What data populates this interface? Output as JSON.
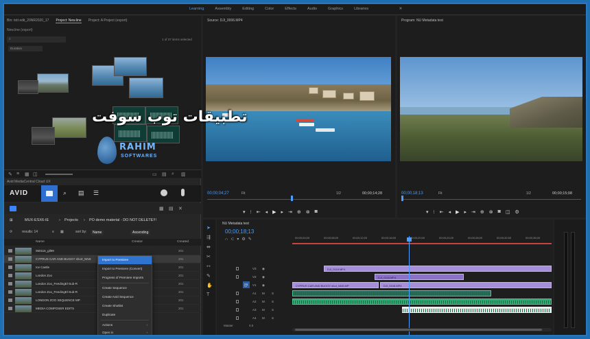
{
  "workspaces": {
    "items": [
      "Learning",
      "Assembly",
      "Editing",
      "Color",
      "Effects",
      "Audio",
      "Graphics",
      "Libraries"
    ],
    "active": "Learning",
    "more": "»"
  },
  "project": {
    "tabs": [
      "Bin: tott edit_20NR2020_17",
      "Project: New.line",
      "Project: A Project (export)"
    ],
    "bin_label": "New.line (export)",
    "search_placeholder": "",
    "item_count": "1 of 37 items selected",
    "dropdown": "Duration"
  },
  "watermark": {
    "line1": "RAHIM",
    "line2": "SOFTWARES"
  },
  "avid": {
    "panel_title": "Avid MediaCentral Cloud UX",
    "logo": "AVID",
    "breadcrumb": [
      "MUX-ESX6-IE",
      "Projects",
      "PO demo material - DO NOT DELETE!!!"
    ],
    "results": "results: 14",
    "sort_by_label": "sort by:",
    "sort_field": "Name",
    "sort_order": "Ascending",
    "columns": [
      "Name",
      "Creator",
      "Created"
    ],
    "rows": [
      {
        "name": "060116_gil99",
        "created": "201"
      },
      {
        "name": "CYPRUS CAR AND BUGGY short_NNS",
        "created": "201"
      },
      {
        "name": "Ice Castle",
        "created": "201"
      },
      {
        "name": "London Zoo",
        "created": "201"
      },
      {
        "name": "London Zoo_FeedingEl-Sub-R",
        "created": "201"
      },
      {
        "name": "London Zoo_FeedingEl-Sub-R",
        "created": "201"
      },
      {
        "name": "LONDON ZOO SEQUENCE MP",
        "created": "201"
      },
      {
        "name": "MEDIA COMPOSER EDITS",
        "created": "201"
      }
    ],
    "context_menu": [
      {
        "label": "Import to Premiere",
        "highlight": true
      },
      {
        "label": "Import to Premiere (Convert)",
        "highlight": false
      },
      {
        "label": "Progress of Premiere Imports",
        "highlight": false
      },
      {
        "label": "Create Sequence",
        "highlight": false
      },
      {
        "label": "Create Avid Sequence",
        "highlight": false
      },
      {
        "label": "Create Shotlist",
        "highlight": false
      },
      {
        "label": "Duplicate",
        "highlight": false
      },
      {
        "label": "Actions",
        "highlight": false
      },
      {
        "label": "Open in",
        "highlight": false
      }
    ]
  },
  "source": {
    "title": "Source: DJI_0006.MP4",
    "timecode": "00;00;04;27",
    "fit": "Fit",
    "duration": "00;00;14;28",
    "fraction": "1/2"
  },
  "program": {
    "title": "Program: NU Metadata test",
    "timecode": "00;00;18;13",
    "fit": "Fit",
    "duration": "00;00;15;08",
    "fraction": "1/2",
    "overlay_text": "تطبيقات توب سوفت"
  },
  "timeline": {
    "title": "NU Metadata test",
    "timecode": "00;00;18;13",
    "ruler": [
      "00;00;04;00",
      "00;00;08;00",
      "00;00;12;00",
      "00;00;16;00",
      "00;00;20;00",
      "00;00;24;00",
      "00;00;28;00",
      "00;00;32;00",
      "00;00;36;00"
    ],
    "tracks": [
      {
        "id": "V3",
        "type": "video"
      },
      {
        "id": "V2",
        "type": "video"
      },
      {
        "id": "V1",
        "type": "video"
      },
      {
        "id": "A1",
        "type": "audio"
      },
      {
        "id": "A2",
        "type": "audio"
      },
      {
        "id": "A3",
        "type": "audio"
      },
      {
        "id": "A4",
        "type": "audio"
      }
    ],
    "clips": {
      "v3": "DJI_0118.MP4",
      "v2": "DJI_0118.MP4",
      "v1a": "CYPRUS CAR AND BUGGY shot_NNS.MP",
      "v1b": "DJI_0106.MP4"
    },
    "master_label": "Master",
    "master_value": "0.0"
  },
  "colors": {
    "accent": "#4a9eff",
    "video_clip": "#a58fd8",
    "audio_clip": "#32a872",
    "menu_highlight": "#2f74d0",
    "frame_border": "#2a78c0"
  }
}
